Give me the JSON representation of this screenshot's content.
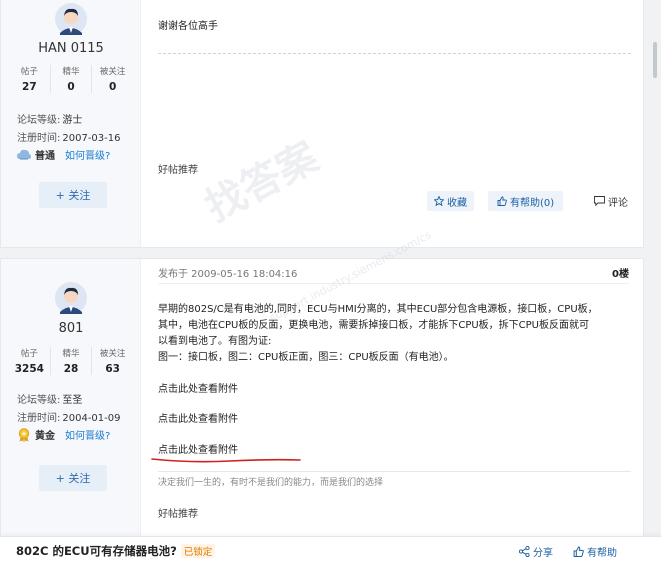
{
  "colors": {
    "accent": "#1a7bd0",
    "follow_bg": "#e6eef7",
    "locked": "#e07b00",
    "underline": "#d21f1f"
  },
  "posts": [
    {
      "user": {
        "name": "HAN 0115",
        "stats": [
          {
            "label": "帖子",
            "value": "27"
          },
          {
            "label": "精华",
            "value": "0"
          },
          {
            "label": "被关注",
            "value": "0"
          }
        ],
        "level_label": "论坛等级:",
        "level_value": "游士",
        "reg_label": "注册时间:",
        "reg_value": "2007-03-16",
        "badge": "普通",
        "badge_icon": "cloud-badge-icon",
        "how_upgrade": "如何晋级?",
        "follow": "+ 关注"
      },
      "content": "谢谢各位高手",
      "recommend": "好帖推荐",
      "actions": {
        "collect": "收藏",
        "helpful": "有帮助(0)",
        "comment": "评论"
      }
    },
    {
      "time": "发布于 2009-05-16 18:04:16",
      "floor": "0楼",
      "user": {
        "name": "801",
        "stats": [
          {
            "label": "帖子",
            "value": "3254"
          },
          {
            "label": "精华",
            "value": "28"
          },
          {
            "label": "被关注",
            "value": "63"
          }
        ],
        "level_label": "论坛等级:",
        "level_value": "至圣",
        "reg_label": "注册时间:",
        "reg_value": "2004-01-09",
        "badge": "黄金",
        "badge_icon": "gold-medal-icon",
        "how_upgrade": "如何晋级?",
        "follow": "+ 关注"
      },
      "content_lines": [
        "早期的802S/C是有电池的,同时，ECU与HMI分离的，其中ECU部分包含电源板，接口板，CPU板，",
        "其中，电池在CPU板的反面，更换电池，需要拆掉接口板，才能拆下CPU板，拆下CPU板反面就可",
        "以看到电池了。有图为证:",
        "图一：接口板，图二：CPU板正面，图三：CPU板反面（有电池）。"
      ],
      "attachments": [
        "点击此处查看附件",
        "点击此处查看附件",
        "点击此处查看附件"
      ],
      "motto": "决定我们一生的，有时不是我们的能力，而是我们的选择",
      "recommend": "好帖推荐"
    }
  ],
  "bottom_bar": {
    "title": "802C 的ECU可有存储器电池?",
    "locked": "已锁定",
    "share": "分享",
    "helpful": "有帮助"
  },
  "watermark": {
    "text": "找答案",
    "site": "support.industry.siemens.com/cs"
  }
}
